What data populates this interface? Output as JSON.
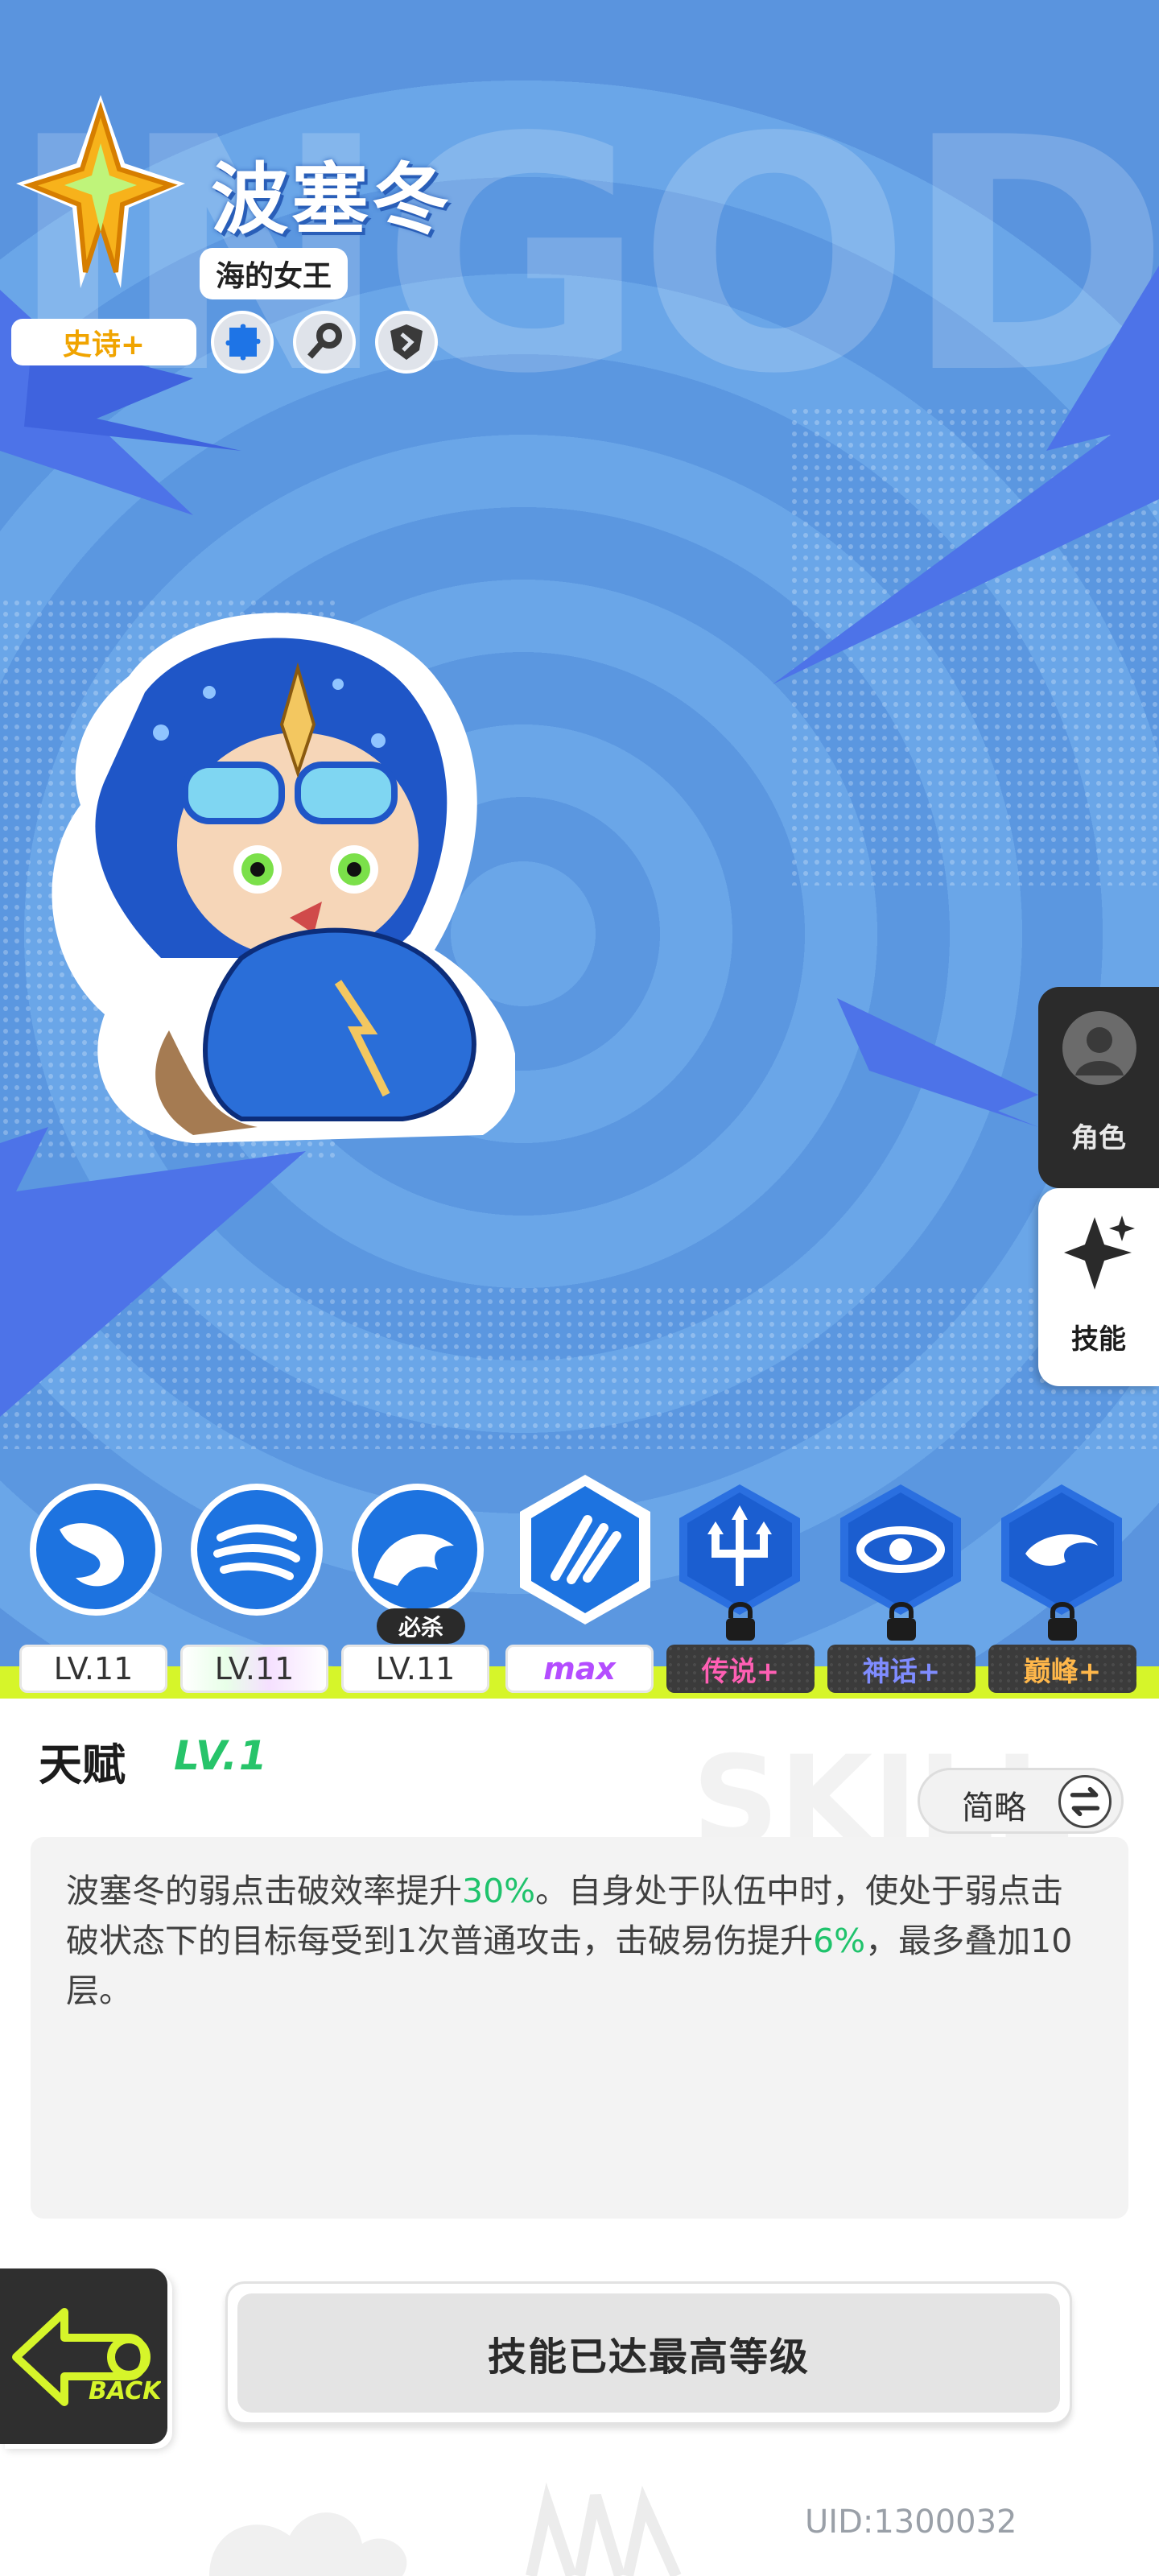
{
  "hero": {
    "name": "波塞冬",
    "title": "海的女王",
    "rarity": "史诗+",
    "bg_letters": "INGOD",
    "traits": [
      "puzzle-icon",
      "key-icon",
      "shield-icon"
    ]
  },
  "side_tabs": {
    "role_label": "角色",
    "skill_label": "技能",
    "active": "技能"
  },
  "skills": {
    "ultimate_tag": "必杀",
    "items": [
      {
        "icon": "water-wave-skill-icon",
        "level": "LV.11"
      },
      {
        "icon": "water-swirl-skill-icon",
        "level": "LV.11"
      },
      {
        "icon": "tidal-wave-skill-icon",
        "level": "LV.11"
      },
      {
        "icon": "talent-claw-skill-icon",
        "level": "max"
      },
      {
        "icon": "trident-skill-icon",
        "level": "传说+",
        "locked": true
      },
      {
        "icon": "vortex-skill-icon",
        "level": "神话+",
        "locked": true
      },
      {
        "icon": "whirlpool-skill-icon",
        "level": "巅峰+",
        "locked": true
      }
    ]
  },
  "talent": {
    "title": "天赋",
    "level": "LV.1",
    "brief_toggle_label": "简略",
    "description_parts": [
      {
        "text": "波塞冬的弱点击破效率提升",
        "highlight": false
      },
      {
        "text": "30%",
        "highlight": true
      },
      {
        "text": "。自身处于队伍中时，使处于弱点击破状态下的目标每受到1次普通攻击，击破易伤提升",
        "highlight": false
      },
      {
        "text": "6%",
        "highlight": true
      },
      {
        "text": "，最多叠加10层。",
        "highlight": false
      }
    ]
  },
  "footer": {
    "back_label": "BACK",
    "maxed_label": "技能已达最高等级",
    "uid": "UID:1300032",
    "panel_bg_text": "SKILL"
  },
  "colors": {
    "highlight_green": "#1fc36c",
    "rarity_gold": "#f0a400",
    "slime_yellow": "#d6f52a",
    "background_blue": "#5b9be3"
  }
}
